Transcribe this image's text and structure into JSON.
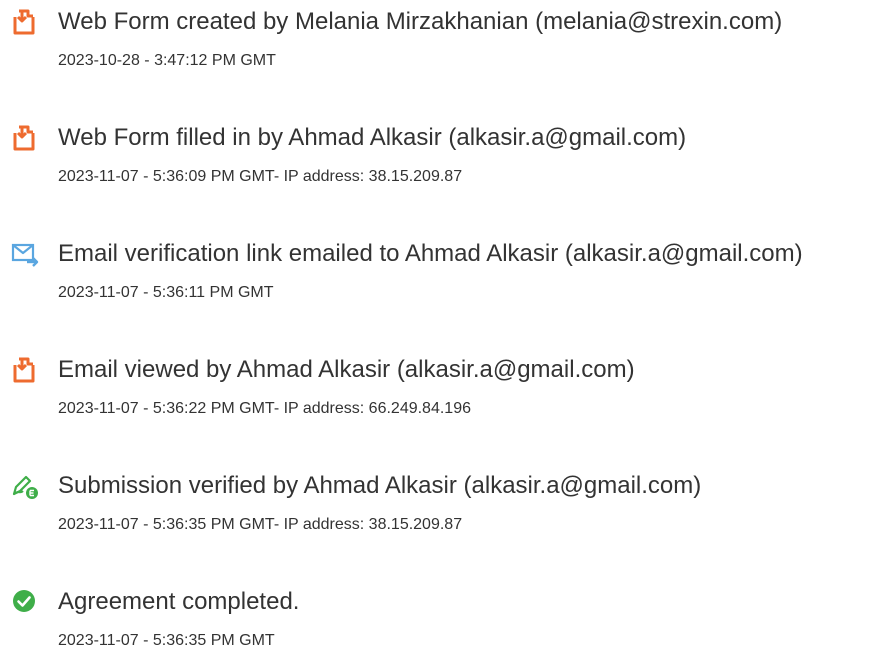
{
  "events": [
    {
      "icon": "document-action-icon",
      "title": "Web Form created by Melania Mirzakhanian (melania@strexin.com)",
      "meta": "2023-10-28 - 3:47:12 PM GMT"
    },
    {
      "icon": "document-action-icon",
      "title": "Web Form filled in by Ahmad Alkasir (alkasir.a@gmail.com)",
      "meta": "2023-11-07 - 5:36:09 PM GMT- IP address: 38.15.209.87"
    },
    {
      "icon": "email-sent-icon",
      "title": "Email verification link emailed to Ahmad Alkasir (alkasir.a@gmail.com)",
      "meta": "2023-11-07 - 5:36:11 PM GMT"
    },
    {
      "icon": "document-action-icon",
      "title": "Email viewed by Ahmad Alkasir (alkasir.a@gmail.com)",
      "meta": "2023-11-07 - 5:36:22 PM GMT- IP address: 66.249.84.196"
    },
    {
      "icon": "signature-verified-icon",
      "title": "Submission verified by Ahmad Alkasir (alkasir.a@gmail.com)",
      "meta": "2023-11-07 - 5:36:35 PM GMT- IP address: 38.15.209.87"
    },
    {
      "icon": "completed-check-icon",
      "title": "Agreement completed.",
      "meta": "2023-11-07 - 5:36:35 PM GMT"
    }
  ],
  "colors": {
    "document_icon": "#ee6b2f",
    "email_icon": "#5aa6e0",
    "signature_icon": "#3fae49",
    "check_icon": "#3fae49",
    "text": "#333333"
  }
}
